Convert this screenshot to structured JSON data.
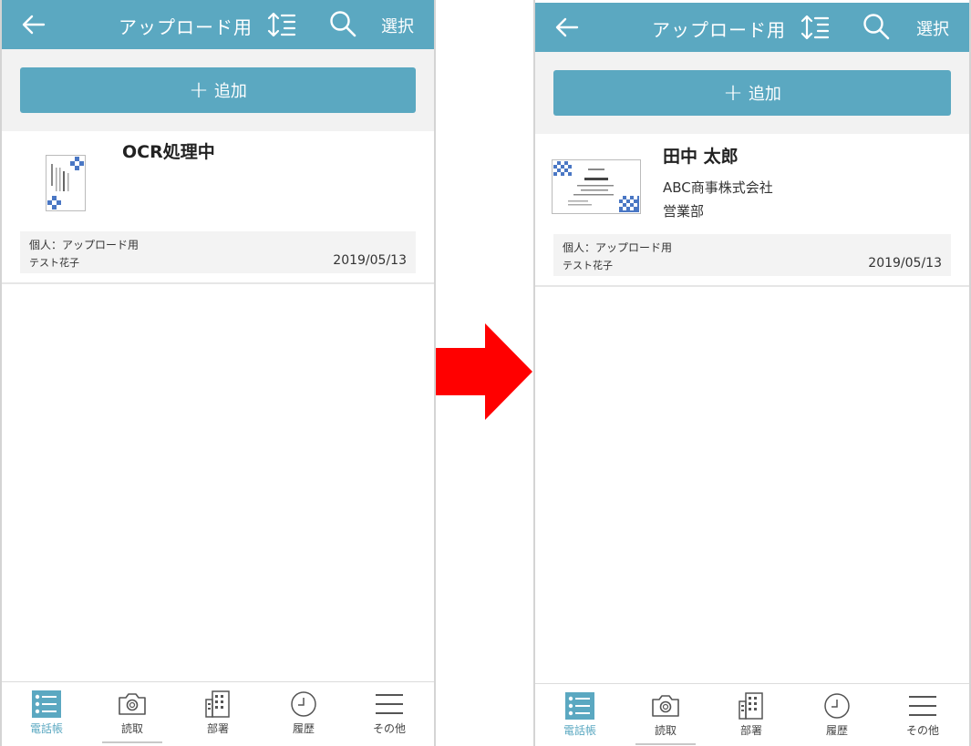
{
  "colors": {
    "accent": "#5ba8c1",
    "arrow": "#ff0000",
    "panel": "#f2f2f2"
  },
  "screens": [
    {
      "topbar": {
        "title": "アップロード用",
        "select_label": "選択",
        "icons": [
          "back-arrow-icon",
          "sort-icon",
          "search-icon"
        ]
      },
      "add_button": {
        "label": "追加"
      },
      "card": {
        "name": "OCR処理中",
        "company": "",
        "department": "",
        "group": "個人：アップロード用",
        "owner": "テスト花子",
        "date": "2019/05/13"
      },
      "tabs": [
        {
          "label": "電話帳",
          "icon": "phonebook-icon",
          "active": true
        },
        {
          "label": "読取",
          "icon": "camera-icon",
          "active": false
        },
        {
          "label": "部署",
          "icon": "building-icon",
          "active": false
        },
        {
          "label": "履歴",
          "icon": "clock-icon",
          "active": false
        },
        {
          "label": "その他",
          "icon": "menu-icon",
          "active": false
        }
      ]
    },
    {
      "topbar": {
        "title": "アップロード用",
        "select_label": "選択",
        "icons": [
          "back-arrow-icon",
          "sort-icon",
          "search-icon"
        ]
      },
      "add_button": {
        "label": "追加"
      },
      "card": {
        "name": "田中 太郎",
        "company": "ABC商事株式会社",
        "department": "営業部",
        "group": "個人：アップロード用",
        "owner": "テスト花子",
        "date": "2019/05/13"
      },
      "tabs": [
        {
          "label": "電話帳",
          "icon": "phonebook-icon",
          "active": true
        },
        {
          "label": "読取",
          "icon": "camera-icon",
          "active": false
        },
        {
          "label": "部署",
          "icon": "building-icon",
          "active": false
        },
        {
          "label": "履歴",
          "icon": "clock-icon",
          "active": false
        },
        {
          "label": "その他",
          "icon": "menu-icon",
          "active": false
        }
      ]
    }
  ]
}
